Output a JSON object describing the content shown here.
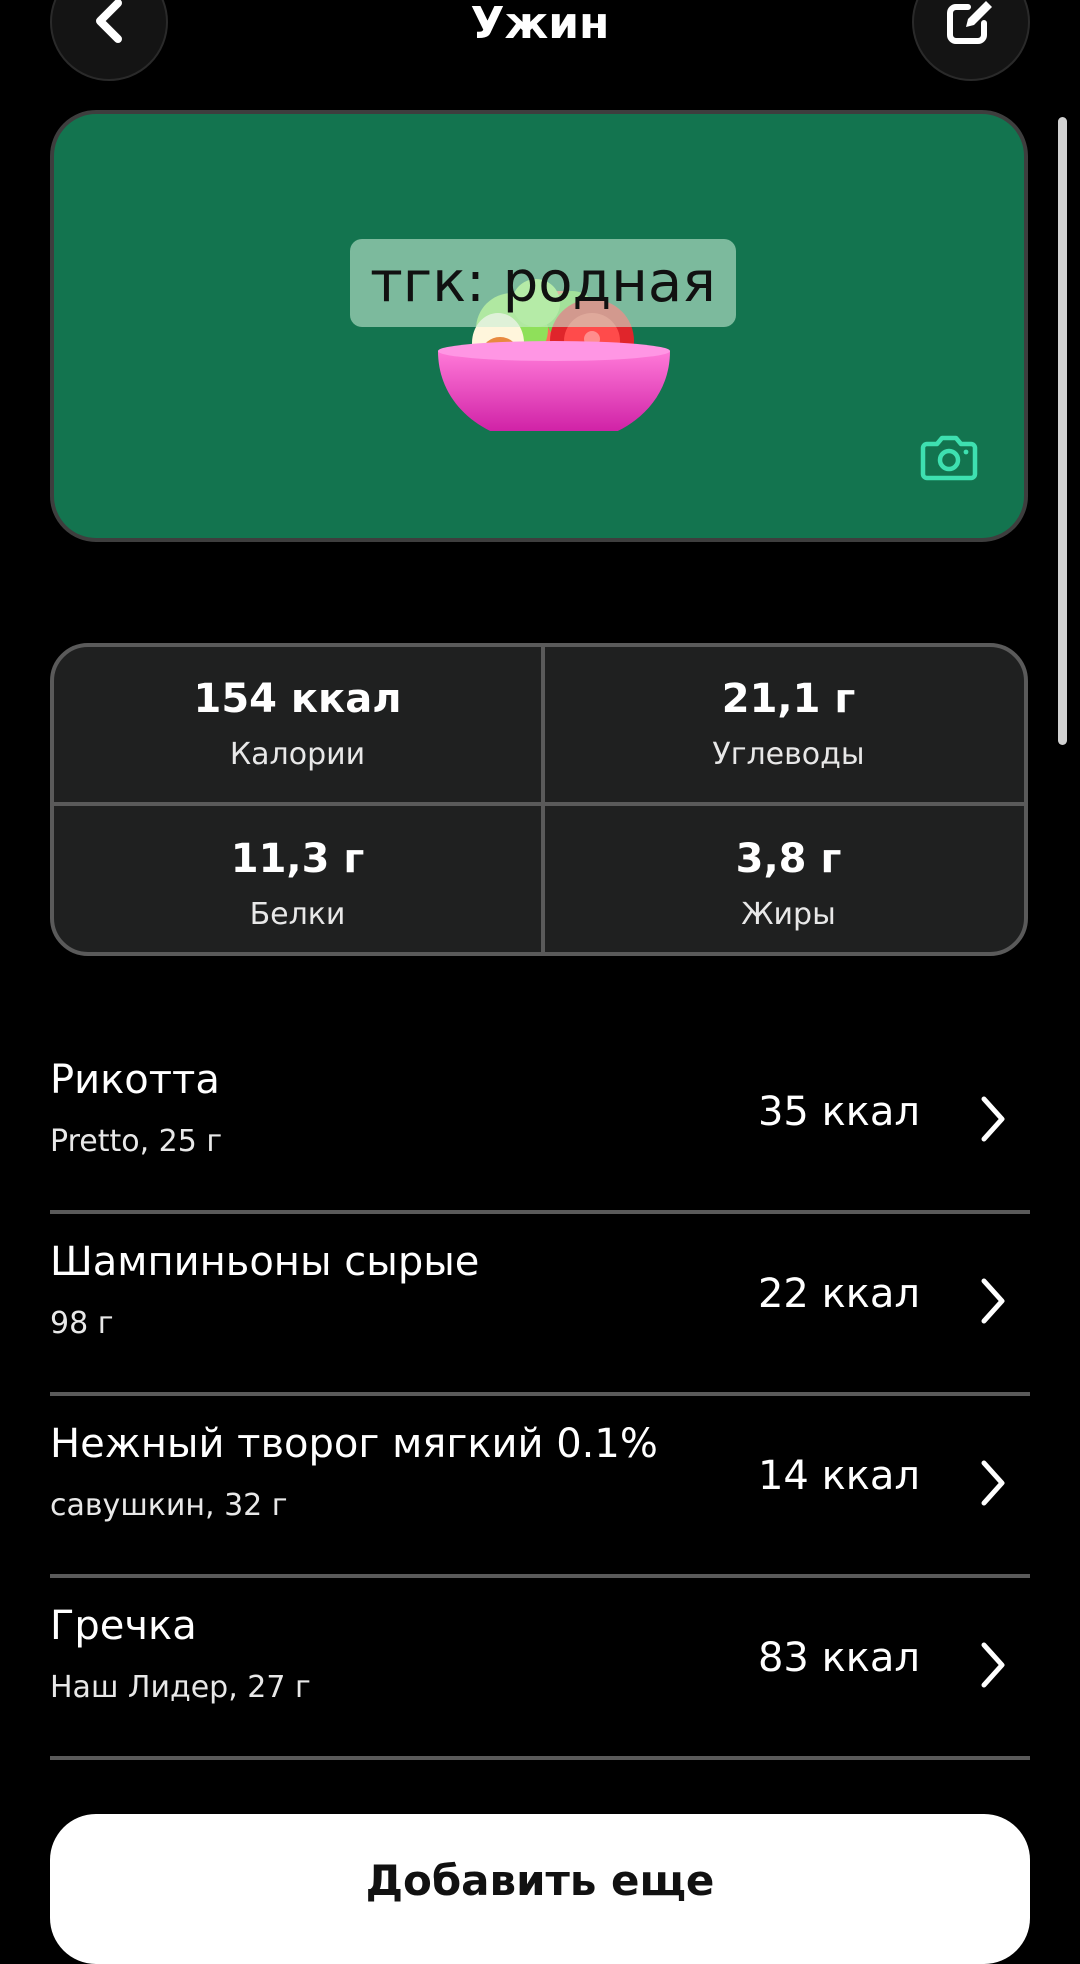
{
  "header": {
    "title": "Ужин",
    "back_icon": "chevron-left-icon",
    "edit_icon": "edit-square-icon"
  },
  "photo": {
    "background_color": "#13744f",
    "illustration": "salad-bowl",
    "watermark_text": "тгк: родная",
    "camera_icon": "camera-icon",
    "camera_color": "#3ee0b0"
  },
  "nutrition": {
    "calories": {
      "value": "154 ккал",
      "label": "Калории"
    },
    "carbs": {
      "value": "21,1 г",
      "label": "Углеводы"
    },
    "protein": {
      "value": "11,3 г",
      "label": "Белки"
    },
    "fat": {
      "value": "3,8 г",
      "label": "Жиры"
    }
  },
  "items": [
    {
      "name": "Рикотта",
      "subtitle": "Pretto, 25 г",
      "kcal": "35 ккал"
    },
    {
      "name": "Шампиньоны сырые",
      "subtitle": "98 г",
      "kcal": "22 ккал"
    },
    {
      "name": "Нежный творог мягкий 0.1%",
      "subtitle": "савушкин, 32 г",
      "kcal": "14 ккал"
    },
    {
      "name": "Гречка",
      "subtitle": "Наш Лидер, 27 г",
      "kcal": "83 ккал"
    }
  ],
  "add_button": {
    "label": "Добавить еще"
  }
}
